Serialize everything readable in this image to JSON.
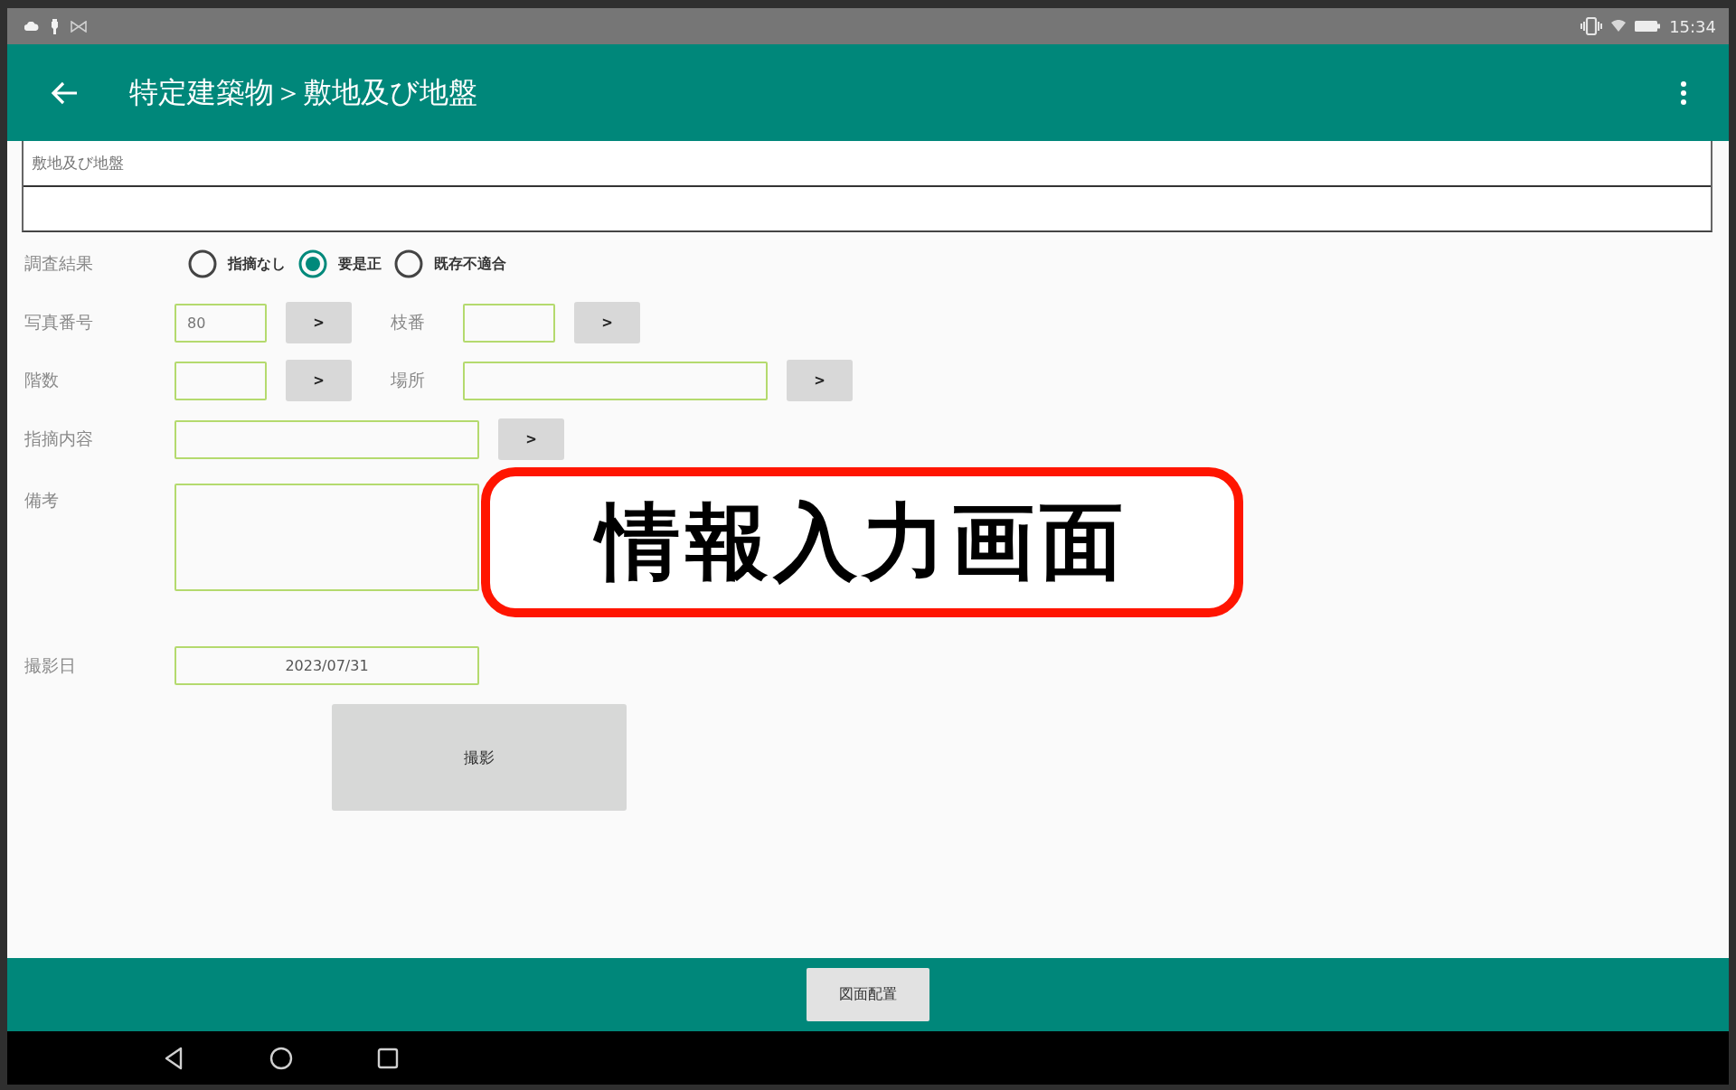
{
  "status_bar": {
    "time": "15:34"
  },
  "app_bar": {
    "title": "特定建築物＞敷地及び地盤"
  },
  "section": {
    "title": "敷地及び地盤"
  },
  "survey_result": {
    "label": "調査結果",
    "options": [
      {
        "label": "指摘なし",
        "selected": false
      },
      {
        "label": "要是正",
        "selected": true
      },
      {
        "label": "既存不適合",
        "selected": false
      }
    ]
  },
  "field_rows": [
    {
      "fields": [
        {
          "label": "写真番号",
          "value": "80",
          "button": ">"
        },
        {
          "label": "枝番",
          "button": ">"
        }
      ]
    },
    {
      "fields": [
        {
          "label": "階数",
          "button": ">"
        },
        {
          "label": "場所",
          "button": ">"
        }
      ]
    },
    {
      "fields": [
        {
          "label": "指摘内容",
          "button": ">"
        }
      ]
    }
  ],
  "remarks": {
    "label": "備考"
  },
  "shot_date": {
    "label": "撮影日",
    "value": "2023/07/31"
  },
  "shoot_button": "撮影",
  "callout": {
    "text": "情報入力画面"
  },
  "bottom_bar": {
    "button": "図面配置"
  }
}
